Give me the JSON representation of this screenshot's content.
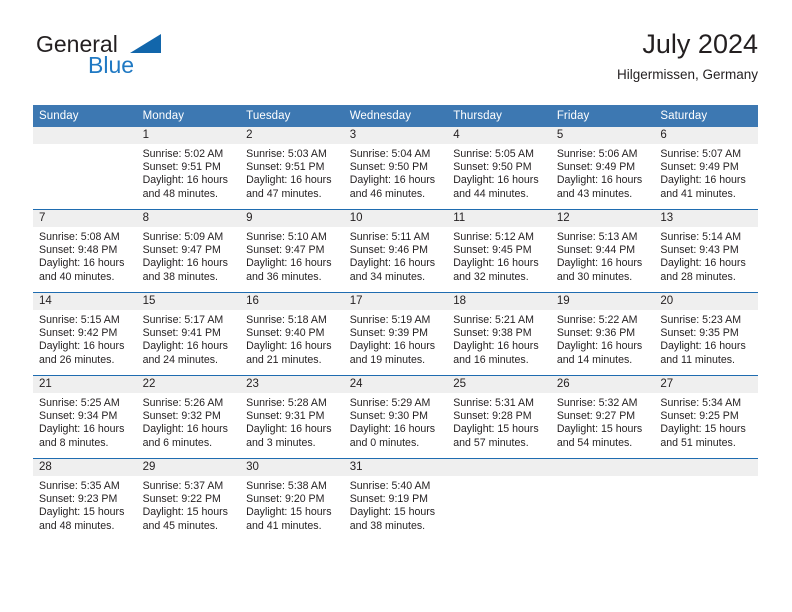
{
  "brand": {
    "name_part1": "General",
    "name_part2": "Blue",
    "icon": "triangle-flag-icon"
  },
  "header": {
    "title": "July 2024",
    "subtitle": "Hilgermissen, Germany"
  },
  "colors": {
    "header_blue": "#3d78b2",
    "divider_blue": "#1f6cb0",
    "brand_blue": "#2079c3",
    "daynum_band": "#efefef",
    "text": "#231f20"
  },
  "weekday_headers": [
    "Sunday",
    "Monday",
    "Tuesday",
    "Wednesday",
    "Thursday",
    "Friday",
    "Saturday"
  ],
  "labels": {
    "sunrise_prefix": "Sunrise:",
    "sunset_prefix": "Sunset:",
    "daylight_prefix": "Daylight:"
  },
  "weeks": [
    [
      {
        "day": "",
        "empty": true,
        "line1": "",
        "line2": "",
        "line3": "",
        "line4": ""
      },
      {
        "day": "1",
        "line1": "Sunrise: 5:02 AM",
        "line2": "Sunset: 9:51 PM",
        "line3": "Daylight: 16 hours",
        "line4": "and 48 minutes."
      },
      {
        "day": "2",
        "line1": "Sunrise: 5:03 AM",
        "line2": "Sunset: 9:51 PM",
        "line3": "Daylight: 16 hours",
        "line4": "and 47 minutes."
      },
      {
        "day": "3",
        "line1": "Sunrise: 5:04 AM",
        "line2": "Sunset: 9:50 PM",
        "line3": "Daylight: 16 hours",
        "line4": "and 46 minutes."
      },
      {
        "day": "4",
        "line1": "Sunrise: 5:05 AM",
        "line2": "Sunset: 9:50 PM",
        "line3": "Daylight: 16 hours",
        "line4": "and 44 minutes."
      },
      {
        "day": "5",
        "line1": "Sunrise: 5:06 AM",
        "line2": "Sunset: 9:49 PM",
        "line3": "Daylight: 16 hours",
        "line4": "and 43 minutes."
      },
      {
        "day": "6",
        "line1": "Sunrise: 5:07 AM",
        "line2": "Sunset: 9:49 PM",
        "line3": "Daylight: 16 hours",
        "line4": "and 41 minutes."
      }
    ],
    [
      {
        "day": "7",
        "line1": "Sunrise: 5:08 AM",
        "line2": "Sunset: 9:48 PM",
        "line3": "Daylight: 16 hours",
        "line4": "and 40 minutes."
      },
      {
        "day": "8",
        "line1": "Sunrise: 5:09 AM",
        "line2": "Sunset: 9:47 PM",
        "line3": "Daylight: 16 hours",
        "line4": "and 38 minutes."
      },
      {
        "day": "9",
        "line1": "Sunrise: 5:10 AM",
        "line2": "Sunset: 9:47 PM",
        "line3": "Daylight: 16 hours",
        "line4": "and 36 minutes."
      },
      {
        "day": "10",
        "line1": "Sunrise: 5:11 AM",
        "line2": "Sunset: 9:46 PM",
        "line3": "Daylight: 16 hours",
        "line4": "and 34 minutes."
      },
      {
        "day": "11",
        "line1": "Sunrise: 5:12 AM",
        "line2": "Sunset: 9:45 PM",
        "line3": "Daylight: 16 hours",
        "line4": "and 32 minutes."
      },
      {
        "day": "12",
        "line1": "Sunrise: 5:13 AM",
        "line2": "Sunset: 9:44 PM",
        "line3": "Daylight: 16 hours",
        "line4": "and 30 minutes."
      },
      {
        "day": "13",
        "line1": "Sunrise: 5:14 AM",
        "line2": "Sunset: 9:43 PM",
        "line3": "Daylight: 16 hours",
        "line4": "and 28 minutes."
      }
    ],
    [
      {
        "day": "14",
        "line1": "Sunrise: 5:15 AM",
        "line2": "Sunset: 9:42 PM",
        "line3": "Daylight: 16 hours",
        "line4": "and 26 minutes."
      },
      {
        "day": "15",
        "line1": "Sunrise: 5:17 AM",
        "line2": "Sunset: 9:41 PM",
        "line3": "Daylight: 16 hours",
        "line4": "and 24 minutes."
      },
      {
        "day": "16",
        "line1": "Sunrise: 5:18 AM",
        "line2": "Sunset: 9:40 PM",
        "line3": "Daylight: 16 hours",
        "line4": "and 21 minutes."
      },
      {
        "day": "17",
        "line1": "Sunrise: 5:19 AM",
        "line2": "Sunset: 9:39 PM",
        "line3": "Daylight: 16 hours",
        "line4": "and 19 minutes."
      },
      {
        "day": "18",
        "line1": "Sunrise: 5:21 AM",
        "line2": "Sunset: 9:38 PM",
        "line3": "Daylight: 16 hours",
        "line4": "and 16 minutes."
      },
      {
        "day": "19",
        "line1": "Sunrise: 5:22 AM",
        "line2": "Sunset: 9:36 PM",
        "line3": "Daylight: 16 hours",
        "line4": "and 14 minutes."
      },
      {
        "day": "20",
        "line1": "Sunrise: 5:23 AM",
        "line2": "Sunset: 9:35 PM",
        "line3": "Daylight: 16 hours",
        "line4": "and 11 minutes."
      }
    ],
    [
      {
        "day": "21",
        "line1": "Sunrise: 5:25 AM",
        "line2": "Sunset: 9:34 PM",
        "line3": "Daylight: 16 hours",
        "line4": "and 8 minutes."
      },
      {
        "day": "22",
        "line1": "Sunrise: 5:26 AM",
        "line2": "Sunset: 9:32 PM",
        "line3": "Daylight: 16 hours",
        "line4": "and 6 minutes."
      },
      {
        "day": "23",
        "line1": "Sunrise: 5:28 AM",
        "line2": "Sunset: 9:31 PM",
        "line3": "Daylight: 16 hours",
        "line4": "and 3 minutes."
      },
      {
        "day": "24",
        "line1": "Sunrise: 5:29 AM",
        "line2": "Sunset: 9:30 PM",
        "line3": "Daylight: 16 hours",
        "line4": "and 0 minutes."
      },
      {
        "day": "25",
        "line1": "Sunrise: 5:31 AM",
        "line2": "Sunset: 9:28 PM",
        "line3": "Daylight: 15 hours",
        "line4": "and 57 minutes."
      },
      {
        "day": "26",
        "line1": "Sunrise: 5:32 AM",
        "line2": "Sunset: 9:27 PM",
        "line3": "Daylight: 15 hours",
        "line4": "and 54 minutes."
      },
      {
        "day": "27",
        "line1": "Sunrise: 5:34 AM",
        "line2": "Sunset: 9:25 PM",
        "line3": "Daylight: 15 hours",
        "line4": "and 51 minutes."
      }
    ],
    [
      {
        "day": "28",
        "line1": "Sunrise: 5:35 AM",
        "line2": "Sunset: 9:23 PM",
        "line3": "Daylight: 15 hours",
        "line4": "and 48 minutes."
      },
      {
        "day": "29",
        "line1": "Sunrise: 5:37 AM",
        "line2": "Sunset: 9:22 PM",
        "line3": "Daylight: 15 hours",
        "line4": "and 45 minutes."
      },
      {
        "day": "30",
        "line1": "Sunrise: 5:38 AM",
        "line2": "Sunset: 9:20 PM",
        "line3": "Daylight: 15 hours",
        "line4": "and 41 minutes."
      },
      {
        "day": "31",
        "line1": "Sunrise: 5:40 AM",
        "line2": "Sunset: 9:19 PM",
        "line3": "Daylight: 15 hours",
        "line4": "and 38 minutes."
      },
      {
        "day": "",
        "empty": true,
        "line1": "",
        "line2": "",
        "line3": "",
        "line4": ""
      },
      {
        "day": "",
        "empty": true,
        "line1": "",
        "line2": "",
        "line3": "",
        "line4": ""
      },
      {
        "day": "",
        "empty": true,
        "line1": "",
        "line2": "",
        "line3": "",
        "line4": ""
      }
    ]
  ]
}
